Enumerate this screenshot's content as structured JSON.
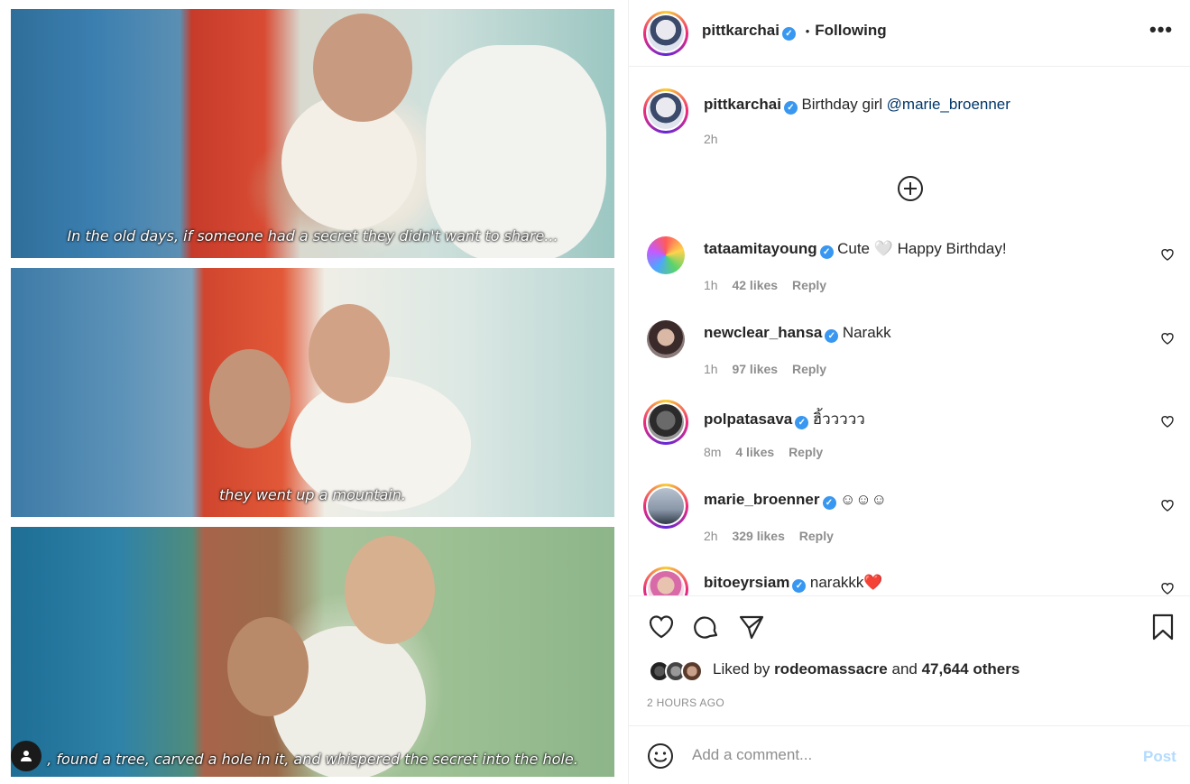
{
  "post": {
    "captions": [
      "In the old days, if someone had a secret they didn't want to share...",
      "they went up a mountain.",
      ", found a tree, carved a hole in it, and whispered the secret into the hole."
    ]
  },
  "header": {
    "username": "pittkarchai",
    "separator": "•",
    "follow_status": "Following",
    "more_icon": "more-horizontal-icon"
  },
  "caption": {
    "username": "pittkarchai",
    "text": "Birthday girl",
    "mention": "@marie_broenner",
    "time": "2h"
  },
  "load_more_icon": "plus-circle-icon",
  "comments": [
    {
      "username": "tataamitayoung",
      "text": "Cute 🤍 Happy Birthday!",
      "time": "1h",
      "likes": "42 likes",
      "reply": "Reply",
      "verified": true
    },
    {
      "username": "newclear_hansa",
      "text": "Narakk",
      "time": "1h",
      "likes": "97 likes",
      "reply": "Reply",
      "verified": true
    },
    {
      "username": "polpatasava",
      "text": "ฮิ้ววววว",
      "time": "8m",
      "likes": "4 likes",
      "reply": "Reply",
      "verified": true
    },
    {
      "username": "marie_broenner",
      "text": "☺☺☺",
      "time": "2h",
      "likes": "329 likes",
      "reply": "Reply",
      "verified": true
    },
    {
      "username": "bitoeyrsiam",
      "text": "narakkk❤️",
      "time": "",
      "likes": "",
      "reply": "",
      "verified": true
    }
  ],
  "actions": {
    "like_icon": "heart-icon",
    "comment_icon": "comment-icon",
    "share_icon": "send-icon",
    "save_icon": "bookmark-icon"
  },
  "likes": {
    "prefix": "Liked by",
    "user": "rodeomassacre",
    "middle": "and",
    "others": "47,644 others"
  },
  "timestamp": "2 HOURS AGO",
  "add_comment": {
    "placeholder": "Add a comment...",
    "post_label": "Post",
    "emoji_icon": "emoji-icon"
  },
  "colors": {
    "verified": "#3897f0",
    "mention": "#00376b",
    "post_disabled": "#b3dbff",
    "muted": "#8e8e8e"
  }
}
